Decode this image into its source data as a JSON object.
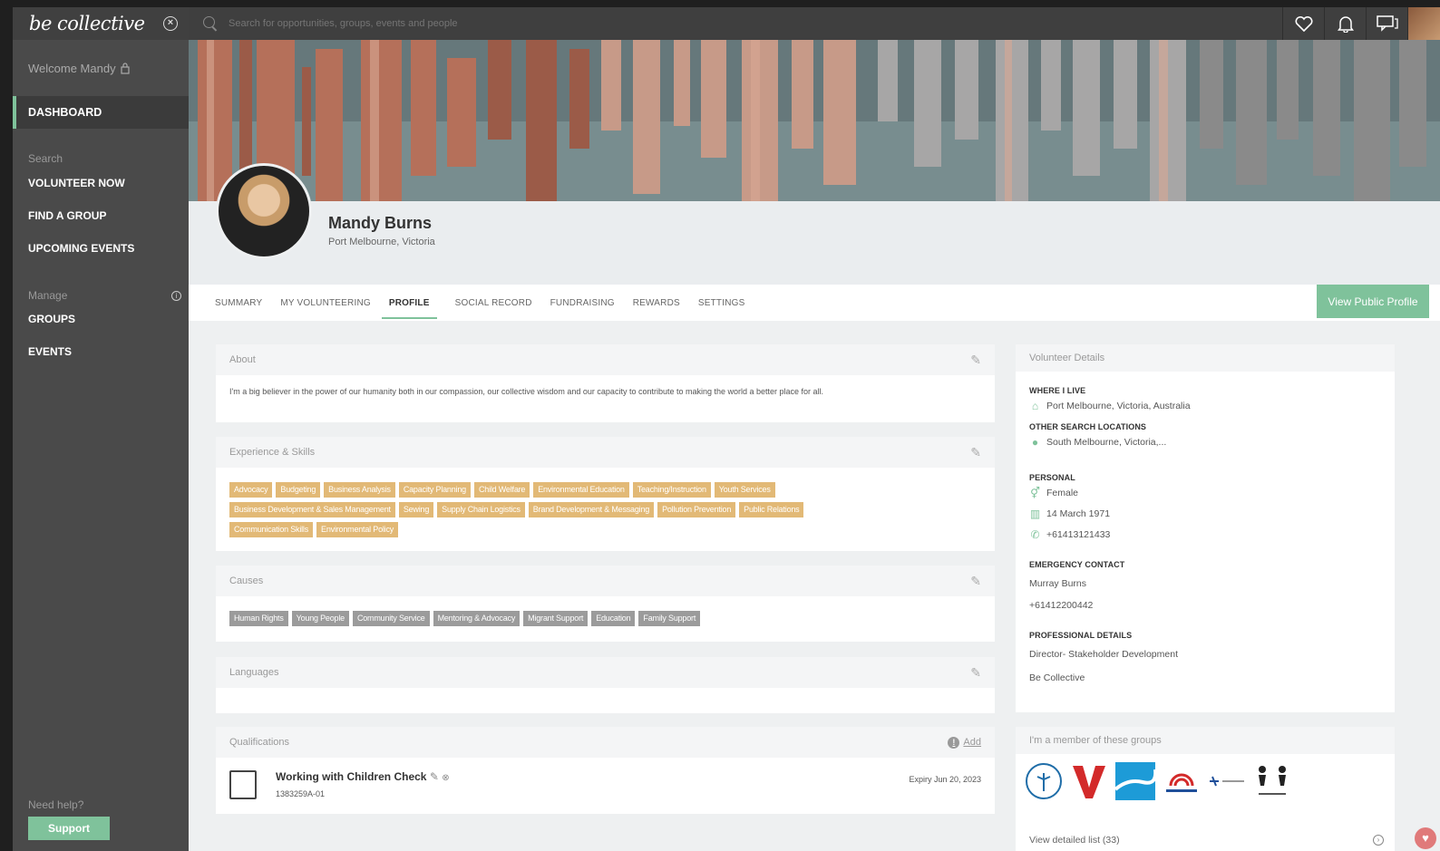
{
  "sidebar": {
    "logo": "be collective",
    "welcome": "Welcome Mandy",
    "dashboard": "DASHBOARD",
    "search_label": "Search",
    "volunteer_now": "VOLUNTEER NOW",
    "find_group": "FIND A GROUP",
    "upcoming_events": "UPCOMING EVENTS",
    "manage_label": "Manage",
    "groups": "GROUPS",
    "events": "EVENTS",
    "need_help": "Need help?",
    "support": "Support"
  },
  "topbar": {
    "search_placeholder": "Search for opportunities, groups, events and people",
    "icons": [
      "heart-icon",
      "bell-icon",
      "chat-icon"
    ]
  },
  "profile": {
    "name": "Mandy Burns",
    "location": "Port Melbourne, Victoria",
    "view_public": "View Public Profile"
  },
  "tabs": [
    "SUMMARY",
    "MY VOLUNTEERING",
    "PROFILE",
    "SOCIAL RECORD",
    "FUNDRAISING",
    "REWARDS",
    "SETTINGS"
  ],
  "about": {
    "title": "About",
    "text": "I'm a big believer in the power of our humanity both in our compassion, our collective wisdom and our capacity to contribute to making the world a better place for all."
  },
  "skills": {
    "title": "Experience & Skills",
    "tags": [
      "Advocacy",
      "Budgeting",
      "Business Analysis",
      "Capacity Planning",
      "Child Welfare",
      "Environmental Education",
      "Teaching/Instruction",
      "Youth Services",
      "Business Development & Sales Management",
      "Sewing",
      "Supply Chain Logistics",
      "Brand Development & Messaging",
      "Pollution Prevention",
      "Public Relations",
      "Communication Skills",
      "Environmental Policy"
    ]
  },
  "causes": {
    "title": "Causes",
    "tags": [
      "Human Rights",
      "Young People",
      "Community Service",
      "Mentoring & Advocacy",
      "Migrant Support",
      "Education",
      "Family Support"
    ]
  },
  "languages": {
    "title": "Languages"
  },
  "qualifications": {
    "title": "Qualifications",
    "add": "Add",
    "item_title": "Working with Children Check",
    "item_number": "1383259A-01",
    "item_expiry": "Expiry Jun 20, 2023"
  },
  "volunteer_details": {
    "title": "Volunteer Details",
    "where_label": "WHERE I LIVE",
    "where_value": "Port Melbourne, Victoria, Australia",
    "other_label": "OTHER SEARCH LOCATIONS",
    "other_value": "South Melbourne, Victoria,...",
    "personal_label": "PERSONAL",
    "gender": "Female",
    "dob": "14 March 1971",
    "phone": "+61413121433",
    "emergency_label": "EMERGENCY CONTACT",
    "emergency_name": "Murray Burns",
    "emergency_phone": "+61412200442",
    "professional_label": "PROFESSIONAL DETAILS",
    "job_title": "Director- Stakeholder Development",
    "company": "Be Collective"
  },
  "groups": {
    "title": "I'm a member of these groups",
    "view_list": "View detailed list (33)"
  },
  "colors": {
    "accent": "#7fc29b",
    "skill_tag": "#e2b976",
    "cause_tag": "#9b9b9b"
  }
}
